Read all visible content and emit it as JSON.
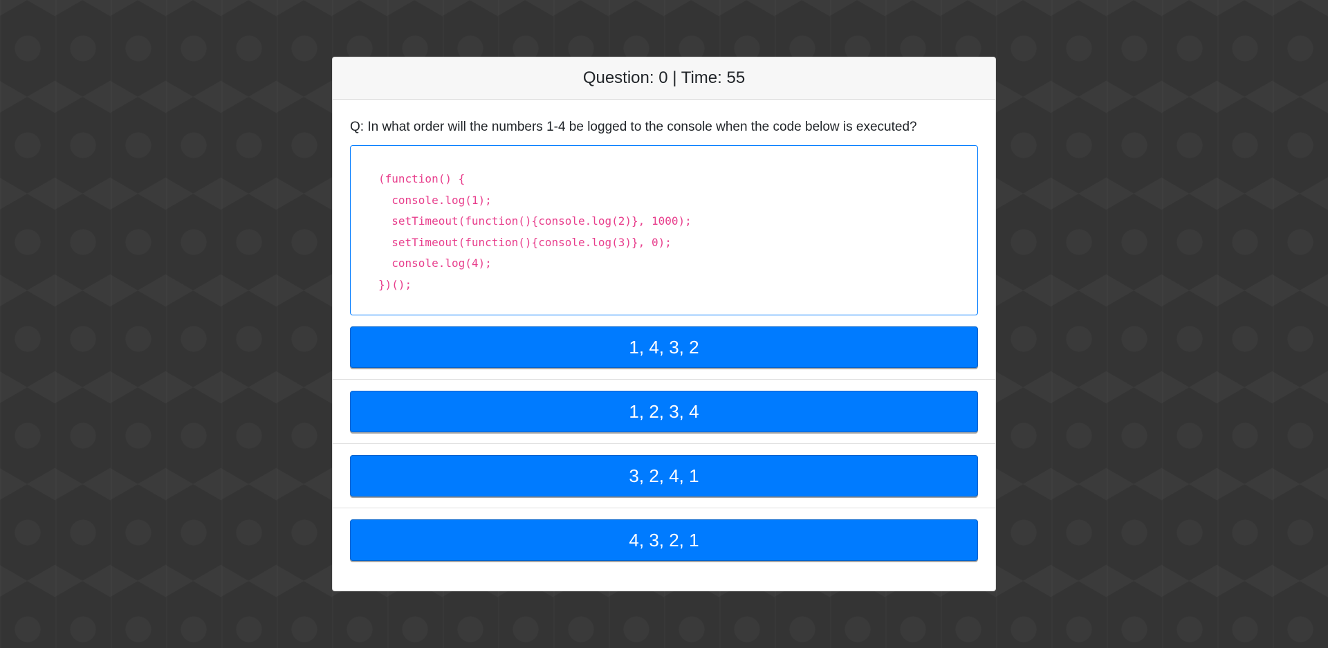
{
  "header": {
    "text": "Question: 0 | Time: 55"
  },
  "question": {
    "text": "Q: In what order will the numbers 1-4 be logged to the console when the code below is executed?",
    "code": "(function() {\n  console.log(1);\n  setTimeout(function(){console.log(2)}, 1000);\n  setTimeout(function(){console.log(3)}, 0);\n  console.log(4);\n})();"
  },
  "answers": [
    {
      "label": "1, 4, 3, 2"
    },
    {
      "label": "1, 2, 3, 4"
    },
    {
      "label": "3, 2, 4, 1"
    },
    {
      "label": "4, 3, 2, 1"
    }
  ],
  "colors": {
    "button": "#007bff",
    "code_text": "#e83e8c",
    "code_border": "#007bff",
    "background": "#343434"
  }
}
